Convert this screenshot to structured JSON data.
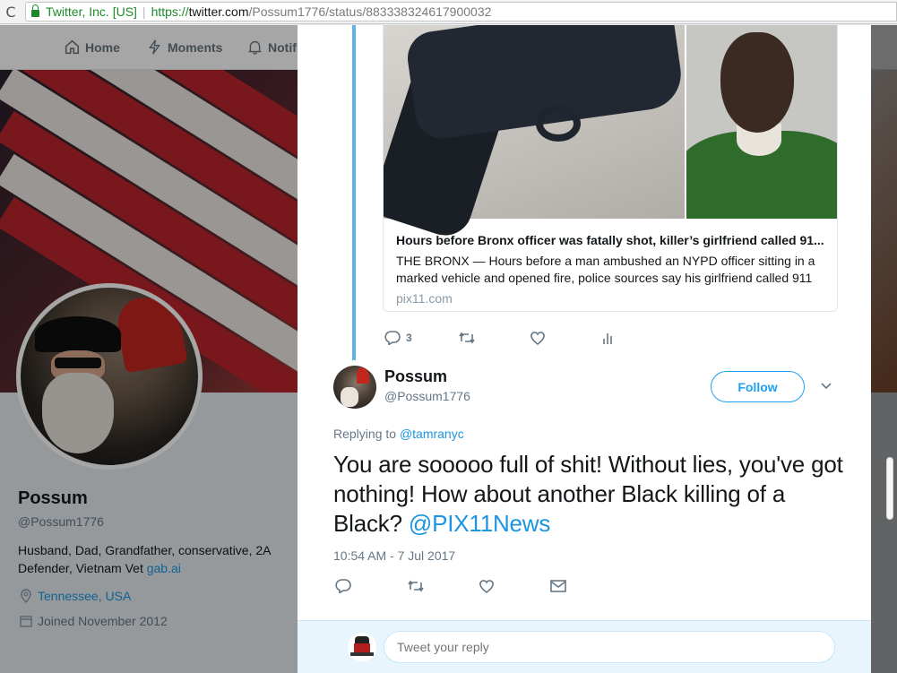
{
  "browser": {
    "reload_icon": "reload-icon",
    "secure_label": "Twitter, Inc. [US]",
    "url_scheme": "https://",
    "url_host": "twitter.com",
    "url_path": "/Possum1776/status/883338324617900032"
  },
  "nav": {
    "items": [
      {
        "label": "Home",
        "icon": "home-icon"
      },
      {
        "label": "Moments",
        "icon": "lightning-icon"
      },
      {
        "label": "Notifi",
        "icon": "bell-icon"
      }
    ]
  },
  "profile": {
    "name": "Possum",
    "handle": "@Possum1776",
    "bio_text": "Husband, Dad, Grandfather, conservative, 2A Defender, Vietnam Vet ",
    "bio_link": "gab.ai",
    "location": "Tennessee, USA",
    "joined": "Joined November 2012"
  },
  "card": {
    "title": "Hours before Bronx officer was fatally shot, killer’s girlfriend called 91...",
    "description": "THE BRONX — Hours before a man ambushed an NYPD officer sitting in a marked vehicle and opened fire, police sources say his girlfriend called 911",
    "domain": "pix11.com"
  },
  "parent_actions": {
    "reply_count": "3",
    "retweet_count": "",
    "like_count": ""
  },
  "tweet": {
    "name": "Possum",
    "handle": "@Possum1776",
    "follow_label": "Follow",
    "replying_prefix": "Replying to ",
    "replying_to": "@tamranyc",
    "text": "You are sooooo full of shit! Without lies, you've got nothing! How about another Black killing of a Black? ",
    "mention": "@PIX11News",
    "timestamp": "10:54 AM - 7 Jul 2017"
  },
  "reply": {
    "placeholder": "Tweet your reply"
  },
  "colors": {
    "accent": "#1da1f2",
    "thread_line": "#5fb3e6",
    "secure_green": "#1d8a2a"
  }
}
